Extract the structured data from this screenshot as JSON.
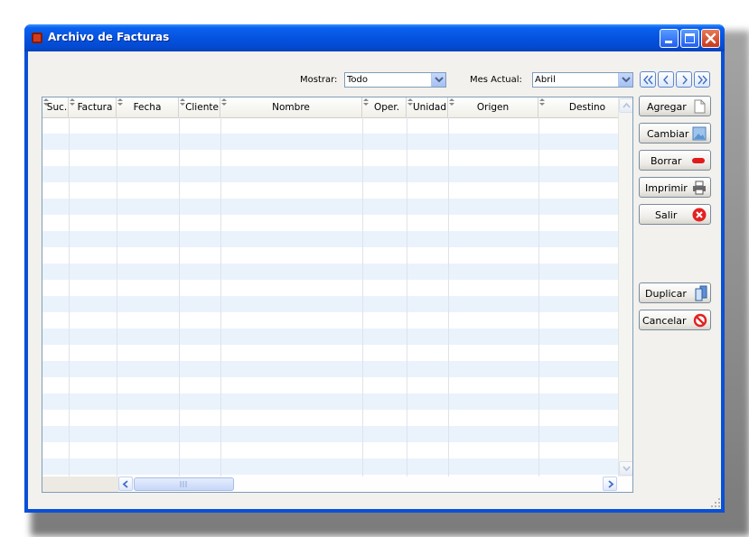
{
  "window": {
    "title": "Archivo de Facturas"
  },
  "toolbar": {
    "show_label": "Mostrar:",
    "show_value": "Todo",
    "month_label": "Mes Actual:",
    "month_value": "Abril"
  },
  "nav": [
    {
      "name": "first-record-button",
      "icon": "double-chevron-left-icon"
    },
    {
      "name": "prev-record-button",
      "icon": "chevron-left-icon"
    },
    {
      "name": "next-record-button",
      "icon": "chevron-right-icon"
    },
    {
      "name": "last-record-button",
      "icon": "double-chevron-right-icon"
    }
  ],
  "actions": {
    "add": {
      "label": "Agregar",
      "icon": "new-document-icon"
    },
    "edit": {
      "label": "Cambiar",
      "icon": "image-edit-icon"
    },
    "delete": {
      "label": "Borrar",
      "icon": "red-minus-icon"
    },
    "print": {
      "label": "Imprimir",
      "icon": "printer-icon"
    },
    "exit": {
      "label": "Salir",
      "icon": "red-x-icon"
    },
    "duplicate": {
      "label": "Duplicar",
      "icon": "copy-icon"
    },
    "cancel": {
      "label": "Cancelar",
      "icon": "prohibited-icon"
    }
  },
  "table": {
    "columns": [
      "Suc.",
      "Factura",
      "Fecha",
      "Cliente",
      "Nombre",
      "Oper.",
      "Unidad",
      "Origen",
      "Destino"
    ],
    "rows": []
  },
  "colors": {
    "titlebar": "#0553e0",
    "row_alt": "#eaf3fc"
  }
}
